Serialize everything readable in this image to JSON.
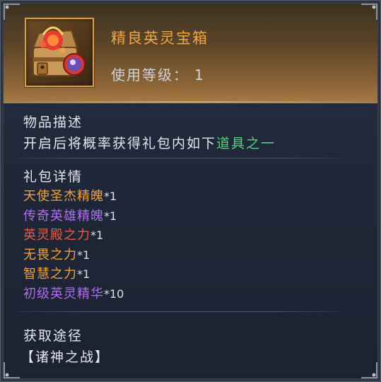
{
  "item": {
    "name": "精良英灵宝箱",
    "level_label": "使用等级：",
    "level_value": "1",
    "icon": "treasure-chest-icon"
  },
  "description": {
    "heading": "物品描述",
    "text_before": "开启后将概率获得礼包内如下",
    "text_highlight": "道具之一"
  },
  "contents": {
    "heading": "礼包详情",
    "items": [
      {
        "name": "天使圣杰精魄",
        "qty": "*1",
        "color": "#f0a23c"
      },
      {
        "name": "传奇英雄精魄",
        "qty": "*1",
        "color": "#b06cf0"
      },
      {
        "name": "英灵殿之力",
        "qty": "*1",
        "color": "#ee5a3f"
      },
      {
        "name": "无畏之力",
        "qty": "*1",
        "color": "#f0a23c"
      },
      {
        "name": "智慧之力",
        "qty": "*1",
        "color": "#f0a23c"
      },
      {
        "name": "初级英灵精华",
        "qty": "*10",
        "color": "#b06cf0"
      }
    ]
  },
  "source": {
    "heading": "获取途径",
    "value": "【诸神之战】"
  },
  "colors": {
    "title": "#f3a63e",
    "highlight": "#4fd67a",
    "frame": "#d7a04d"
  }
}
